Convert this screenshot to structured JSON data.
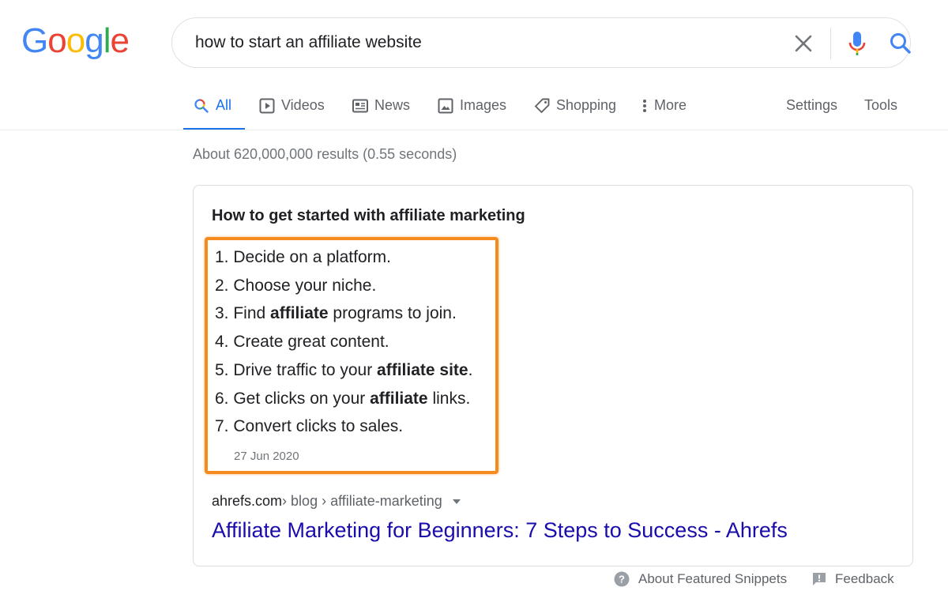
{
  "logo": {
    "text": "Google",
    "colors": [
      "#4285F4",
      "#EA4335",
      "#FBBC05",
      "#4285F4",
      "#34A853",
      "#EA4335"
    ]
  },
  "search": {
    "query": "how to start an affiliate website"
  },
  "tabs": [
    {
      "label": "All",
      "icon": "search-icon",
      "active": true
    },
    {
      "label": "Videos",
      "icon": "play-icon"
    },
    {
      "label": "News",
      "icon": "news-icon"
    },
    {
      "label": "Images",
      "icon": "image-icon"
    },
    {
      "label": "Shopping",
      "icon": "tag-icon"
    },
    {
      "label": "More",
      "icon": "kebab-icon"
    },
    {
      "label": "Settings"
    },
    {
      "label": "Tools"
    }
  ],
  "result_stats": "About 620,000,000 results (0.55 seconds)",
  "snippet": {
    "title": "How to get started with affiliate marketing",
    "steps": [
      [
        "1. Decide on a platform."
      ],
      [
        "2. Choose your niche."
      ],
      [
        "3. Find ",
        {
          "b": "affiliate"
        },
        " programs to join."
      ],
      [
        "4. Create great content."
      ],
      [
        "5. Drive traffic to your ",
        {
          "b": "affiliate site"
        },
        "."
      ],
      [
        "6. Get clicks on your ",
        {
          "b": "affiliate"
        },
        " links."
      ],
      [
        "7. Convert clicks to sales."
      ]
    ],
    "date": "27 Jun 2020",
    "highlight_color": "#F58B1F",
    "breadcrumb": {
      "domain": "ahrefs.com",
      "path": " › blog › affiliate-marketing"
    },
    "link_title": "Affiliate Marketing for Beginners: 7 Steps to Success - Ahrefs",
    "link_color": "#1A0DAB"
  },
  "footer": {
    "about": "About Featured Snippets",
    "feedback": "Feedback"
  },
  "colors": {
    "accent": "#1A73E8",
    "muted": "#5F6368"
  }
}
